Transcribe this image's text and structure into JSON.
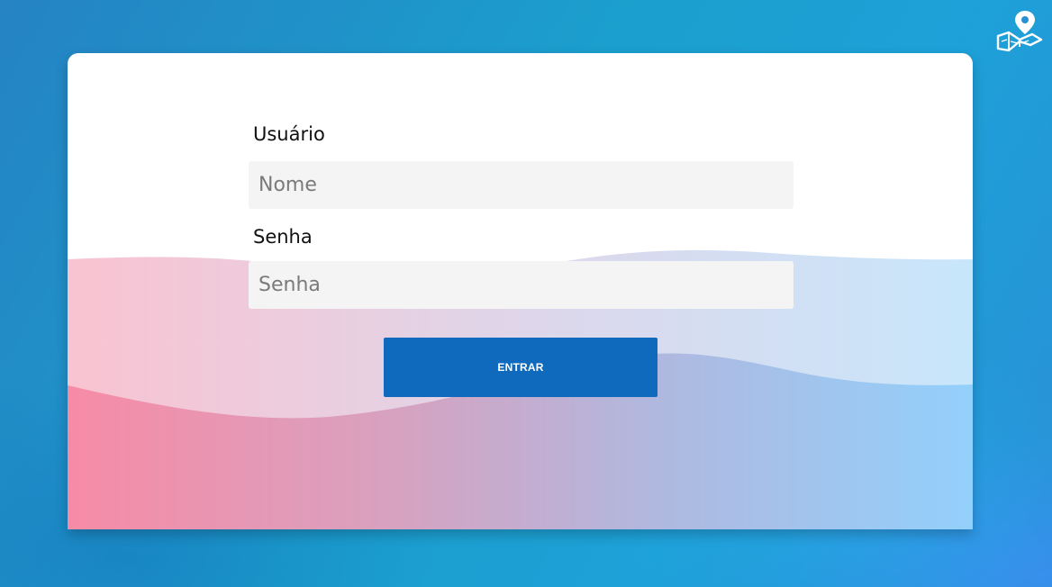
{
  "login": {
    "username_label": "Usuário",
    "username_placeholder": "Nome",
    "password_label": "Senha",
    "password_placeholder": "Senha",
    "submit_label": "ENTRAR"
  },
  "icons": {
    "top_right": "map-location-pin-icon"
  },
  "colors": {
    "background": "#1b9fcd",
    "button": "#0f6abe",
    "input_background": "#f4f4f4",
    "wave_pink": "#f78ba6",
    "wave_blue": "#92d0fb",
    "wave_light_pink": "#f9c3d1",
    "wave_light_blue": "#c8e6fb"
  }
}
